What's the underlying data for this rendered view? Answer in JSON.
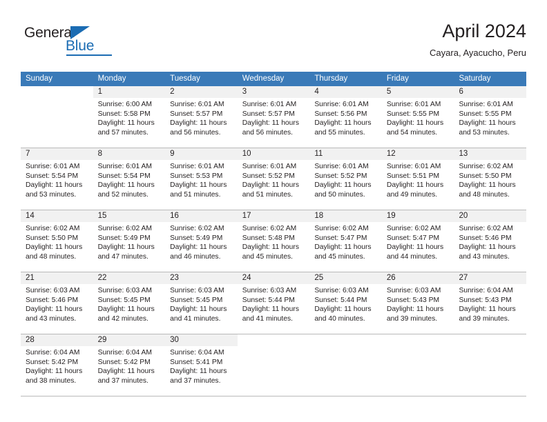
{
  "brand": {
    "name_part1": "General",
    "name_part2": "Blue",
    "triangle_icon": "triangle-icon",
    "colors": {
      "blue": "#1b6cb3",
      "dark": "#231f20"
    }
  },
  "header": {
    "month_title": "April 2024",
    "location": "Cayara, Ayacucho, Peru"
  },
  "calendar": {
    "header_color": "#3a7ab8",
    "daynum_band_color": "#f1f1f1",
    "weekday_headers": [
      "Sunday",
      "Monday",
      "Tuesday",
      "Wednesday",
      "Thursday",
      "Friday",
      "Saturday"
    ],
    "weeks": [
      [
        {
          "day": "",
          "sunrise": "",
          "sunset": "",
          "daylight_line1": "",
          "daylight_line2": "",
          "blank": true
        },
        {
          "day": "1",
          "sunrise": "Sunrise: 6:00 AM",
          "sunset": "Sunset: 5:58 PM",
          "daylight_line1": "Daylight: 11 hours",
          "daylight_line2": "and 57 minutes."
        },
        {
          "day": "2",
          "sunrise": "Sunrise: 6:01 AM",
          "sunset": "Sunset: 5:57 PM",
          "daylight_line1": "Daylight: 11 hours",
          "daylight_line2": "and 56 minutes."
        },
        {
          "day": "3",
          "sunrise": "Sunrise: 6:01 AM",
          "sunset": "Sunset: 5:57 PM",
          "daylight_line1": "Daylight: 11 hours",
          "daylight_line2": "and 56 minutes."
        },
        {
          "day": "4",
          "sunrise": "Sunrise: 6:01 AM",
          "sunset": "Sunset: 5:56 PM",
          "daylight_line1": "Daylight: 11 hours",
          "daylight_line2": "and 55 minutes."
        },
        {
          "day": "5",
          "sunrise": "Sunrise: 6:01 AM",
          "sunset": "Sunset: 5:55 PM",
          "daylight_line1": "Daylight: 11 hours",
          "daylight_line2": "and 54 minutes."
        },
        {
          "day": "6",
          "sunrise": "Sunrise: 6:01 AM",
          "sunset": "Sunset: 5:55 PM",
          "daylight_line1": "Daylight: 11 hours",
          "daylight_line2": "and 53 minutes."
        }
      ],
      [
        {
          "day": "7",
          "sunrise": "Sunrise: 6:01 AM",
          "sunset": "Sunset: 5:54 PM",
          "daylight_line1": "Daylight: 11 hours",
          "daylight_line2": "and 53 minutes."
        },
        {
          "day": "8",
          "sunrise": "Sunrise: 6:01 AM",
          "sunset": "Sunset: 5:54 PM",
          "daylight_line1": "Daylight: 11 hours",
          "daylight_line2": "and 52 minutes."
        },
        {
          "day": "9",
          "sunrise": "Sunrise: 6:01 AM",
          "sunset": "Sunset: 5:53 PM",
          "daylight_line1": "Daylight: 11 hours",
          "daylight_line2": "and 51 minutes."
        },
        {
          "day": "10",
          "sunrise": "Sunrise: 6:01 AM",
          "sunset": "Sunset: 5:52 PM",
          "daylight_line1": "Daylight: 11 hours",
          "daylight_line2": "and 51 minutes."
        },
        {
          "day": "11",
          "sunrise": "Sunrise: 6:01 AM",
          "sunset": "Sunset: 5:52 PM",
          "daylight_line1": "Daylight: 11 hours",
          "daylight_line2": "and 50 minutes."
        },
        {
          "day": "12",
          "sunrise": "Sunrise: 6:01 AM",
          "sunset": "Sunset: 5:51 PM",
          "daylight_line1": "Daylight: 11 hours",
          "daylight_line2": "and 49 minutes."
        },
        {
          "day": "13",
          "sunrise": "Sunrise: 6:02 AM",
          "sunset": "Sunset: 5:50 PM",
          "daylight_line1": "Daylight: 11 hours",
          "daylight_line2": "and 48 minutes."
        }
      ],
      [
        {
          "day": "14",
          "sunrise": "Sunrise: 6:02 AM",
          "sunset": "Sunset: 5:50 PM",
          "daylight_line1": "Daylight: 11 hours",
          "daylight_line2": "and 48 minutes."
        },
        {
          "day": "15",
          "sunrise": "Sunrise: 6:02 AM",
          "sunset": "Sunset: 5:49 PM",
          "daylight_line1": "Daylight: 11 hours",
          "daylight_line2": "and 47 minutes."
        },
        {
          "day": "16",
          "sunrise": "Sunrise: 6:02 AM",
          "sunset": "Sunset: 5:49 PM",
          "daylight_line1": "Daylight: 11 hours",
          "daylight_line2": "and 46 minutes."
        },
        {
          "day": "17",
          "sunrise": "Sunrise: 6:02 AM",
          "sunset": "Sunset: 5:48 PM",
          "daylight_line1": "Daylight: 11 hours",
          "daylight_line2": "and 45 minutes."
        },
        {
          "day": "18",
          "sunrise": "Sunrise: 6:02 AM",
          "sunset": "Sunset: 5:47 PM",
          "daylight_line1": "Daylight: 11 hours",
          "daylight_line2": "and 45 minutes."
        },
        {
          "day": "19",
          "sunrise": "Sunrise: 6:02 AM",
          "sunset": "Sunset: 5:47 PM",
          "daylight_line1": "Daylight: 11 hours",
          "daylight_line2": "and 44 minutes."
        },
        {
          "day": "20",
          "sunrise": "Sunrise: 6:02 AM",
          "sunset": "Sunset: 5:46 PM",
          "daylight_line1": "Daylight: 11 hours",
          "daylight_line2": "and 43 minutes."
        }
      ],
      [
        {
          "day": "21",
          "sunrise": "Sunrise: 6:03 AM",
          "sunset": "Sunset: 5:46 PM",
          "daylight_line1": "Daylight: 11 hours",
          "daylight_line2": "and 43 minutes."
        },
        {
          "day": "22",
          "sunrise": "Sunrise: 6:03 AM",
          "sunset": "Sunset: 5:45 PM",
          "daylight_line1": "Daylight: 11 hours",
          "daylight_line2": "and 42 minutes."
        },
        {
          "day": "23",
          "sunrise": "Sunrise: 6:03 AM",
          "sunset": "Sunset: 5:45 PM",
          "daylight_line1": "Daylight: 11 hours",
          "daylight_line2": "and 41 minutes."
        },
        {
          "day": "24",
          "sunrise": "Sunrise: 6:03 AM",
          "sunset": "Sunset: 5:44 PM",
          "daylight_line1": "Daylight: 11 hours",
          "daylight_line2": "and 41 minutes."
        },
        {
          "day": "25",
          "sunrise": "Sunrise: 6:03 AM",
          "sunset": "Sunset: 5:44 PM",
          "daylight_line1": "Daylight: 11 hours",
          "daylight_line2": "and 40 minutes."
        },
        {
          "day": "26",
          "sunrise": "Sunrise: 6:03 AM",
          "sunset": "Sunset: 5:43 PM",
          "daylight_line1": "Daylight: 11 hours",
          "daylight_line2": "and 39 minutes."
        },
        {
          "day": "27",
          "sunrise": "Sunrise: 6:04 AM",
          "sunset": "Sunset: 5:43 PM",
          "daylight_line1": "Daylight: 11 hours",
          "daylight_line2": "and 39 minutes."
        }
      ],
      [
        {
          "day": "28",
          "sunrise": "Sunrise: 6:04 AM",
          "sunset": "Sunset: 5:42 PM",
          "daylight_line1": "Daylight: 11 hours",
          "daylight_line2": "and 38 minutes."
        },
        {
          "day": "29",
          "sunrise": "Sunrise: 6:04 AM",
          "sunset": "Sunset: 5:42 PM",
          "daylight_line1": "Daylight: 11 hours",
          "daylight_line2": "and 37 minutes."
        },
        {
          "day": "30",
          "sunrise": "Sunrise: 6:04 AM",
          "sunset": "Sunset: 5:41 PM",
          "daylight_line1": "Daylight: 11 hours",
          "daylight_line2": "and 37 minutes."
        },
        {
          "day": "",
          "sunrise": "",
          "sunset": "",
          "daylight_line1": "",
          "daylight_line2": "",
          "blank": true
        },
        {
          "day": "",
          "sunrise": "",
          "sunset": "",
          "daylight_line1": "",
          "daylight_line2": "",
          "blank": true
        },
        {
          "day": "",
          "sunrise": "",
          "sunset": "",
          "daylight_line1": "",
          "daylight_line2": "",
          "blank": true
        },
        {
          "day": "",
          "sunrise": "",
          "sunset": "",
          "daylight_line1": "",
          "daylight_line2": "",
          "blank": true
        }
      ]
    ]
  }
}
